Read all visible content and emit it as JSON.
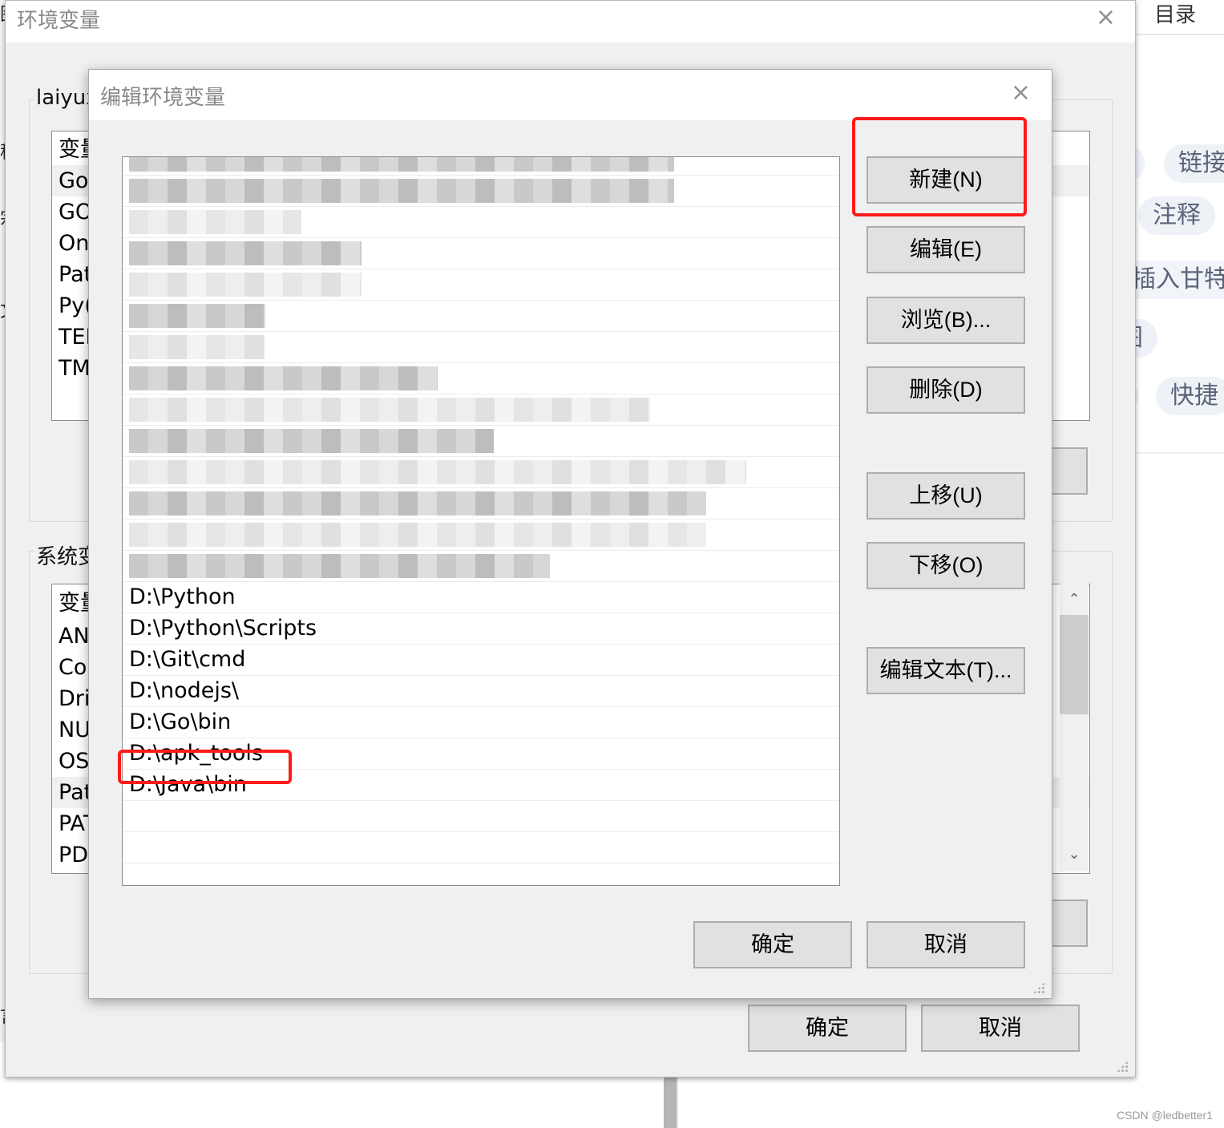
{
  "background_page": {
    "left_fragments": [
      "图",
      "程",
      "宗",
      "文",
      "言"
    ],
    "toc_title": "目录",
    "chips": [
      "链接",
      "注释",
      "插入甘特",
      "图",
      "快捷"
    ],
    "watermark": "CSDN @ledbetter1"
  },
  "outer_dialog": {
    "title": "环境变量",
    "close_icon": "×",
    "user_group_label": "laiyux",
    "user_vars": {
      "header": "变量",
      "rows": [
        "Go",
        "GO",
        "On",
        "Pat",
        "Py(",
        "TEI",
        "TM"
      ],
      "selected_index": 0
    },
    "system_group_label": "系统变",
    "system_vars": {
      "header": "变量",
      "rows": [
        "AN",
        "Cor",
        "Dri",
        "NU",
        "OS",
        "Pat",
        "PAT",
        "PD"
      ],
      "selected_index": 5
    },
    "ok_label": "确定",
    "cancel_label": "取消"
  },
  "edit_dialog": {
    "title": "编辑环境变量",
    "close_icon": "×",
    "entries": [
      {
        "text": "",
        "blurred": true
      },
      {
        "text": "",
        "blurred": true
      },
      {
        "text": "",
        "blurred": true
      },
      {
        "text": "",
        "blurred": true
      },
      {
        "text": "",
        "blurred": true
      },
      {
        "text": "",
        "blurred": true
      },
      {
        "text": "",
        "blurred": true
      },
      {
        "text": "",
        "blurred": true
      },
      {
        "text": "",
        "blurred": true
      },
      {
        "text": "",
        "blurred": true
      },
      {
        "text": "",
        "blurred": true
      },
      {
        "text": "",
        "blurred": true
      },
      {
        "text": "",
        "blurred": true
      },
      {
        "text": "",
        "blurred": true
      },
      {
        "text": "D:\\Python",
        "blurred": false
      },
      {
        "text": "D:\\Python\\Scripts",
        "blurred": false
      },
      {
        "text": "D:\\Git\\cmd",
        "blurred": false
      },
      {
        "text": "D:\\nodejs\\",
        "blurred": false
      },
      {
        "text": "D:\\Go\\bin",
        "blurred": false
      },
      {
        "text": "D:\\apk_tools",
        "blurred": false,
        "highlighted": true
      },
      {
        "text": "D:\\Java\\bin",
        "blurred": false
      },
      {
        "text": "",
        "blurred": false
      },
      {
        "text": "",
        "blurred": false
      }
    ],
    "buttons": {
      "new": "新建(N)",
      "edit": "编辑(E)",
      "browse": "浏览(B)...",
      "delete": "删除(D)",
      "move_up": "上移(U)",
      "move_down": "下移(O)",
      "edit_text": "编辑文本(T)..."
    },
    "ok_label": "确定",
    "cancel_label": "取消"
  },
  "annotations": {
    "highlight_color": "#ff1a1a"
  }
}
